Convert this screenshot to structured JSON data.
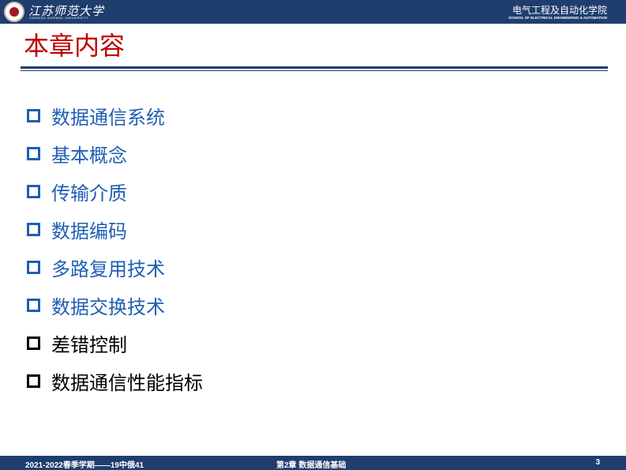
{
  "header": {
    "university_cn": "江苏师范大学",
    "university_en": "JIANGSU NORMAL UNIVERSITY",
    "school_cn": "电气工程及自动化学院",
    "school_en": "SCHOOL OF ELECTRICAL ENGINEERING & AUTOMATION",
    "logo_icon": "university-seal-icon",
    "bar_color": "#1f3e6e"
  },
  "title": "本章内容",
  "title_color": "#c00000",
  "agenda": [
    {
      "label": "数据通信系统",
      "color": "#1f5fb4"
    },
    {
      "label": "基本概念",
      "color": "#1f5fb4"
    },
    {
      "label": "传输介质",
      "color": "#1f5fb4"
    },
    {
      "label": "数据编码",
      "color": "#1f5fb4"
    },
    {
      "label": "多路复用技术",
      "color": "#1f5fb4"
    },
    {
      "label": "数据交换技术",
      "color": "#1f5fb4"
    },
    {
      "label": "差错控制",
      "color": "#000000"
    },
    {
      "label": "数据通信性能指标",
      "color": "#000000"
    }
  ],
  "bullet_icon": "hollow-square-bullet-icon",
  "footer": {
    "left": "2021-2022春季学期——19中俄41",
    "center": "第2章 数据通信基础",
    "page_number": "3"
  }
}
